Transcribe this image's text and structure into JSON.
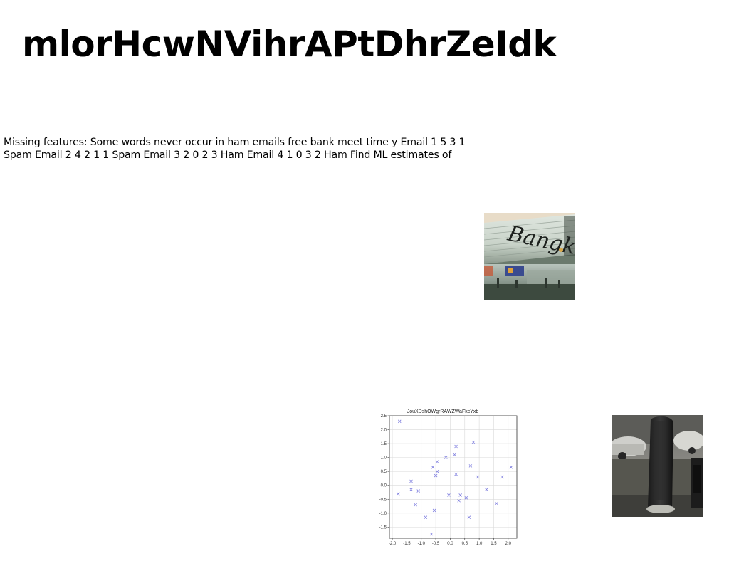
{
  "page": {
    "title": "mlorHcwNVihrAPtDhrZeIdk",
    "body_text": "Missing features: Some words never occur in ham emails free bank meet time y Email 1 5 3 1 Spam Email 2 4 2 1 1 Spam Email 3 2 0 2 3 Ham Email 4 1 0 3 2 Ham Find ML estimates of"
  },
  "images": {
    "bangkok_photo": {
      "sign_text": "Bangkok"
    },
    "street_photo": {}
  },
  "colors": {
    "marker": "#7f7fdf",
    "grid": "#d9d9d9",
    "axis": "#333333"
  },
  "chart_data": {
    "type": "scatter",
    "title": "JouXDshOWgrRAWZWaFkcYxb",
    "xlabel": "",
    "ylabel": "",
    "xlim": [
      -2.1,
      2.3
    ],
    "ylim": [
      -1.9,
      2.5
    ],
    "grid": true,
    "marker": "x",
    "xticks": [
      -2.0,
      -1.5,
      -1.0,
      -0.5,
      0.0,
      0.5,
      1.0,
      1.5,
      2.0
    ],
    "yticks": [
      -1.5,
      -1.0,
      -0.5,
      0.0,
      0.5,
      1.0,
      1.5,
      2.0,
      2.5
    ],
    "xtick_labels": [
      "-2.0",
      "-1.5",
      "-1.0",
      "-0.5",
      "0.0",
      "0.5",
      "1.0",
      "1.5",
      "2.0"
    ],
    "ytick_labels": [
      "-1.5",
      "-1.0",
      "-0.5",
      "0.0",
      "0.5",
      "1.0",
      "1.5",
      "2.0",
      "2.5"
    ],
    "x": [
      -1.8,
      -1.75,
      -1.35,
      -1.35,
      -1.2,
      -1.1,
      -0.85,
      -0.65,
      -0.6,
      -0.55,
      -0.5,
      -0.45,
      -0.45,
      -0.15,
      -0.05,
      0.15,
      0.2,
      0.2,
      0.3,
      0.35,
      0.55,
      0.65,
      0.7,
      0.8,
      0.95,
      1.25,
      1.6,
      1.8,
      2.1
    ],
    "y": [
      -0.3,
      2.3,
      0.15,
      -0.15,
      -0.7,
      -0.2,
      -1.15,
      -1.75,
      0.65,
      -0.9,
      0.35,
      0.5,
      0.85,
      1.0,
      -0.35,
      1.1,
      1.4,
      0.4,
      -0.55,
      -0.35,
      -0.45,
      -1.15,
      0.7,
      1.55,
      0.3,
      -0.15,
      -0.65,
      0.3,
      0.65
    ]
  }
}
